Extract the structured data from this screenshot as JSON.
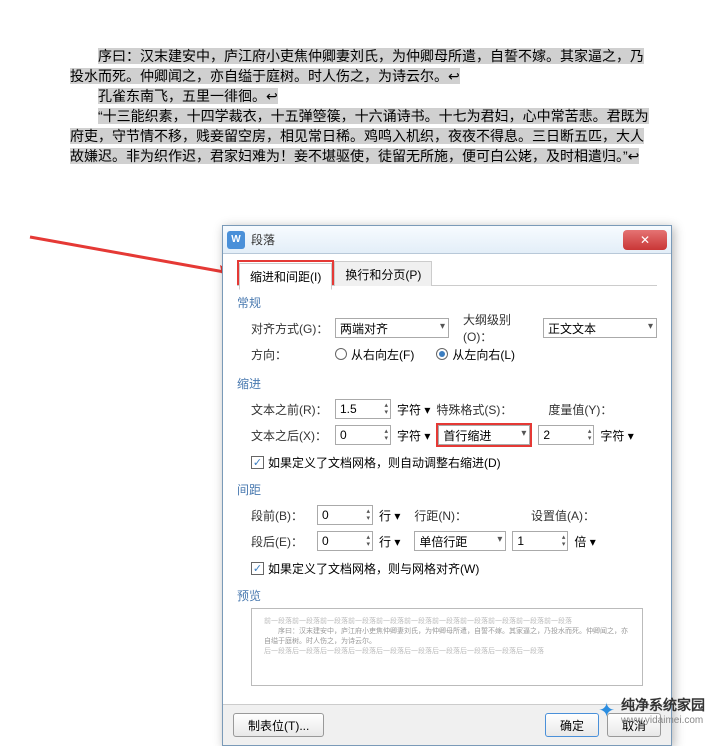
{
  "document": {
    "p1": "序曰：汉末建安中，庐江府小吏焦仲卿妻刘氏，为仲卿母所遣，自誓不嫁。其家逼之，乃投水而死。仲卿闻之，亦自缢于庭树。时人伤之，为诗云尔。↩",
    "p2": "孔雀东南飞，五里一徘徊。↩",
    "p3": "“十三能织素，十四学裁衣，十五弹箜篌，十六诵诗书。十七为君妇，心中常苦悲。君既为府吏，守节情不移，贱妾留空房，相见常日稀。鸡鸣入机织，夜夜不得息。三日断五匹，大人故嫌迟。非为织作迟，君家妇难为！妾不堪驱使，徒留无所施，便可白公姥，及时相遣归。”↩"
  },
  "dialog": {
    "title": "段落",
    "tabs": {
      "indent": "缩进和间距(I)",
      "page": "换行和分页(P)"
    },
    "sections": {
      "general": "常规",
      "indent": "缩进",
      "spacing": "间距",
      "preview": "预览"
    },
    "labels": {
      "alignment": "对齐方式(G)：",
      "outline": "大纲级别(O)：",
      "direction": "方向：",
      "rtl": "从右向左(F)",
      "ltr": "从左向右(L)",
      "textBefore": "文本之前(R)：",
      "textAfter": "文本之后(X)：",
      "special": "特殊格式(S)：",
      "measure": "度量值(Y)：",
      "spaceBefore": "段前(B)：",
      "spaceAfter": "段后(E)：",
      "lineSpacing": "行距(N)：",
      "setValue": "设置值(A)：",
      "gridIndent": "如果定义了文档网格，则自动调整右缩进(D)",
      "gridSpacing": "如果定义了文档网格，则与网格对齐(W)"
    },
    "values": {
      "alignment": "两端对齐",
      "outline": "正文文本",
      "textBefore": "1.5",
      "textAfter": "0",
      "special": "首行缩进",
      "measure": "2",
      "spaceBefore": "0",
      "spaceAfter": "0",
      "lineSpacing": "单倍行距",
      "setValue": "1"
    },
    "units": {
      "char": "字符 ▾",
      "line": "行 ▾",
      "multiple": "倍 ▾"
    },
    "buttons": {
      "tabstop": "制表位(T)...",
      "ok": "确定",
      "cancel": "取消"
    }
  },
  "watermark": {
    "text": "纯净系统家园",
    "url": "www.yidaimei.com"
  }
}
